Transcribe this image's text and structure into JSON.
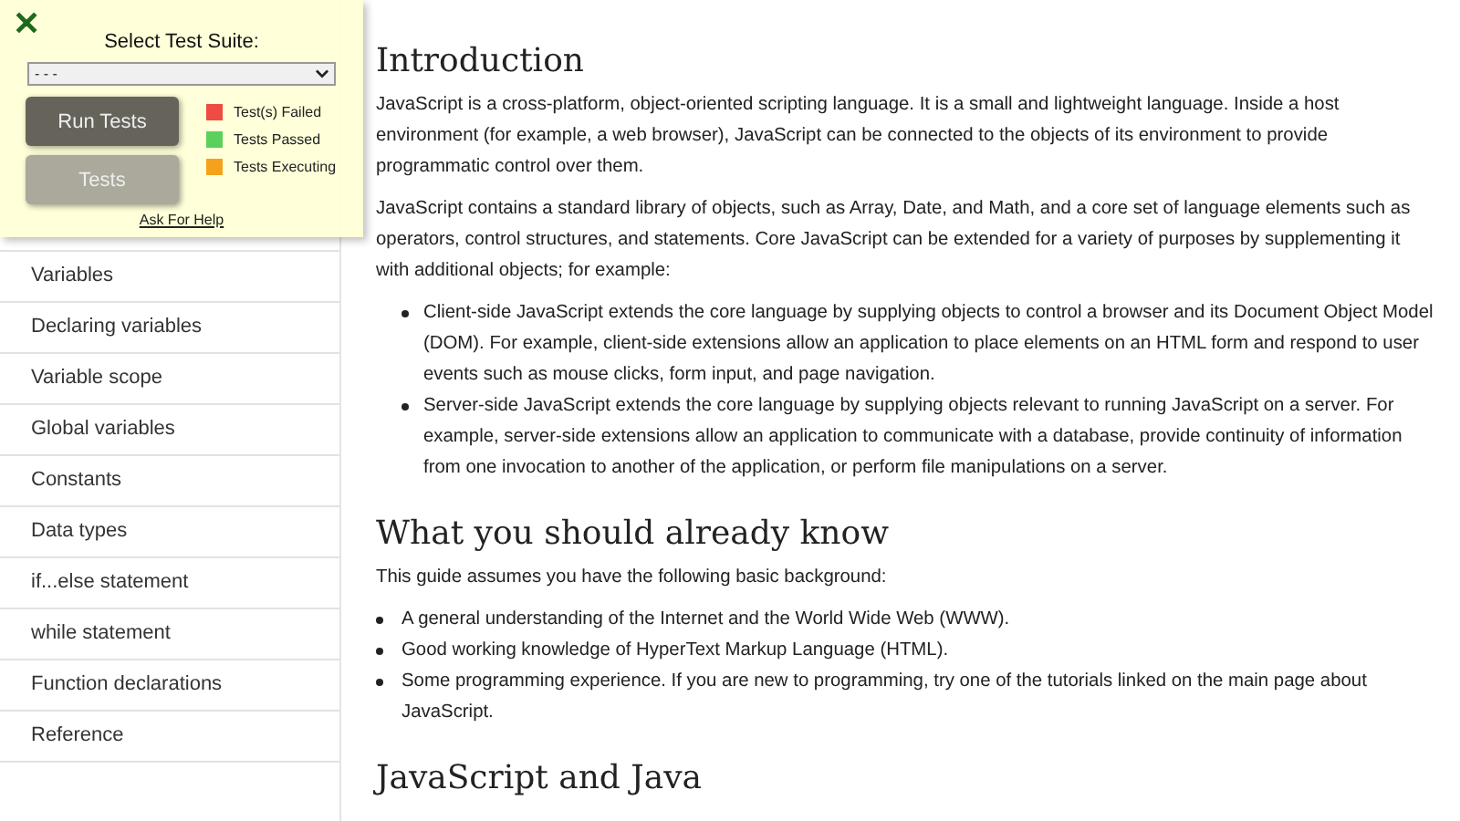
{
  "sidebar": {
    "items": [
      {
        "label": "Variables"
      },
      {
        "label": "Declaring variables"
      },
      {
        "label": "Variable scope"
      },
      {
        "label": "Global variables"
      },
      {
        "label": "Constants"
      },
      {
        "label": "Data types"
      },
      {
        "label": "if...else statement"
      },
      {
        "label": "while statement"
      },
      {
        "label": "Function declarations"
      },
      {
        "label": "Reference"
      }
    ]
  },
  "test_panel": {
    "close": "✕",
    "label": "Select Test Suite:",
    "select_value": "- - -",
    "buttons": [
      {
        "label": "Run Tests",
        "kind": "dark"
      },
      {
        "label": "Tests",
        "kind": "light"
      }
    ],
    "legend": [
      {
        "label": "Test(s) Failed",
        "color": "#ef4a43"
      },
      {
        "label": "Tests Passed",
        "color": "#5bd05b"
      },
      {
        "label": "Tests Executing",
        "color": "#f4a21e"
      }
    ],
    "help_link": "Ask For Help"
  },
  "main": {
    "sections": [
      {
        "heading": "Introduction",
        "blocks": [
          {
            "kind": "paragraph",
            "text": "JavaScript is a cross-platform, object-oriented scripting language. It is a small and lightweight language. Inside a host environment (for example, a web browser), JavaScript can be connected to the objects of its environment to provide programmatic control over them."
          },
          {
            "kind": "paragraph",
            "text": "JavaScript contains a standard library of objects, such as Array, Date, and Math, and a core set of language elements such as operators, control structures, and statements. Core JavaScript can be extended for a variety of purposes by supplementing it with additional objects; for example:"
          },
          {
            "kind": "list",
            "items": [
              "Client-side JavaScript extends the core language by supplying objects to control a browser and its Document Object Model (DOM). For example, client-side extensions allow an application to place elements on an HTML form and respond to user events such as mouse clicks, form input, and page navigation.",
              "Server-side JavaScript extends the core language by supplying objects relevant to running JavaScript on a server. For example, server-side extensions allow an application to communicate with a database, provide continuity of information from one invocation to another of the application, or perform file manipulations on a server."
            ]
          }
        ]
      },
      {
        "heading": "What you should already know",
        "blocks": [
          {
            "kind": "paragraph",
            "text": "This guide assumes you have the following basic background:"
          },
          {
            "kind": "flatlist",
            "items": [
              "A general understanding of the Internet and the World Wide Web (WWW).",
              "Good working knowledge of HyperText Markup Language (HTML).",
              "Some programming experience. If you are new to programming, try one of the tutorials linked on the main page about JavaScript."
            ]
          }
        ]
      },
      {
        "heading": "JavaScript and Java"
      }
    ]
  }
}
